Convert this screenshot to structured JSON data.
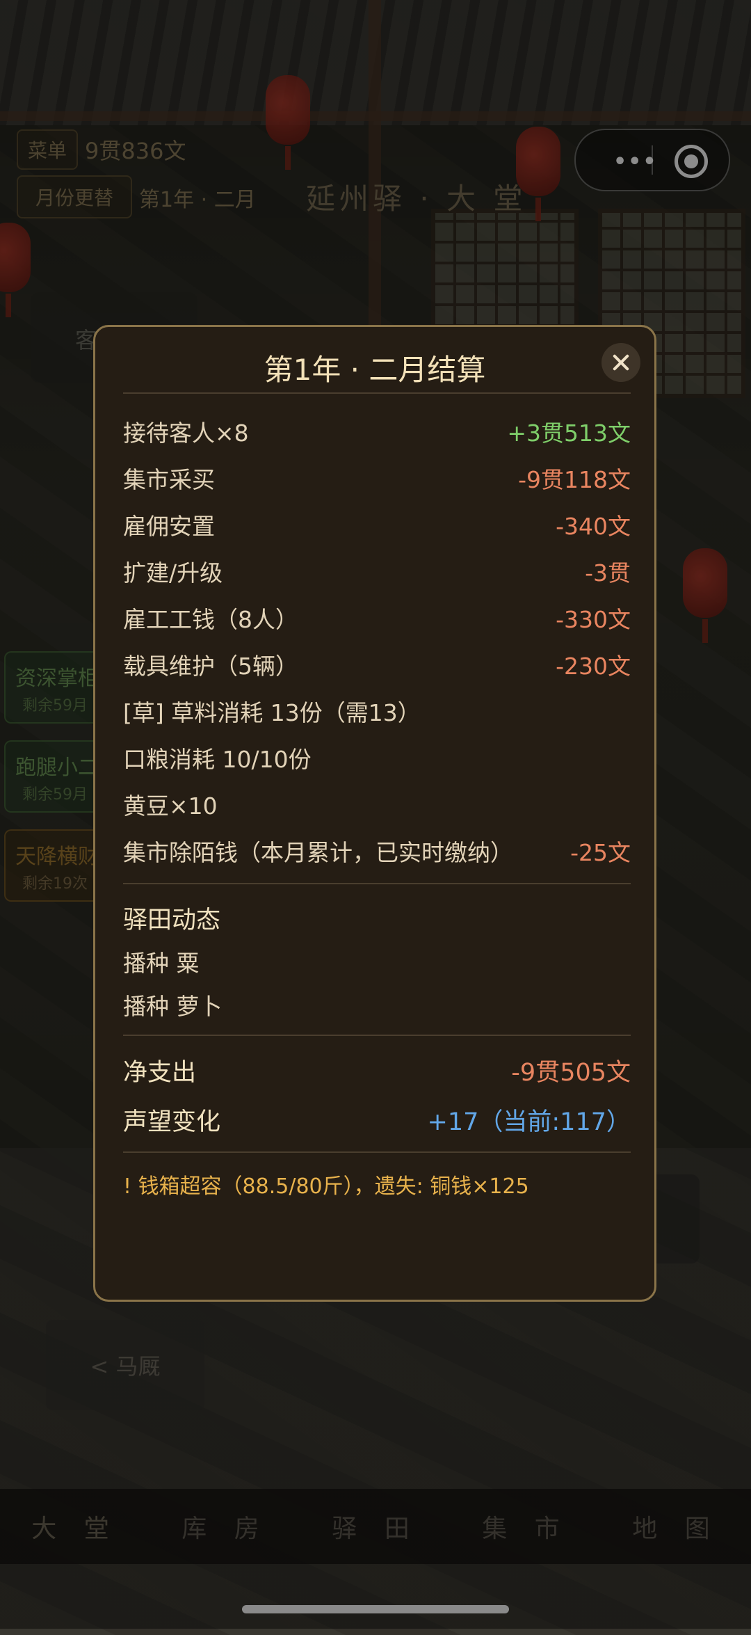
{
  "hud": {
    "menu_label": "菜单",
    "money": "9贯836文",
    "month_change_label": "月份更替",
    "date": "第1年 · 二月",
    "location_title": "延州驿 · 大 堂",
    "ghost_panel_text": "客"
  },
  "capsule": {
    "more_icon": "more-dots-icon",
    "close_icon": "target-icon"
  },
  "side_staff": [
    {
      "name": "资深掌柜",
      "remaining": "剩余59月"
    },
    {
      "name": "跑腿小二",
      "remaining": "剩余59月"
    },
    {
      "name": "天降横财",
      "remaining": "剩余19次"
    }
  ],
  "back_button_label": "< 马厩",
  "bottom_nav": [
    "大 堂",
    "库 房",
    "驿 田",
    "集 市",
    "地 图"
  ],
  "settlement": {
    "title": "第1年 · 二月结算",
    "lines": [
      {
        "label": "接待客人×8",
        "value": "+3贯513文",
        "tone": "pos"
      },
      {
        "label": "集市采买",
        "value": "-9贯118文",
        "tone": "neg"
      },
      {
        "label": "雇佣安置",
        "value": "-340文",
        "tone": "neg"
      },
      {
        "label": "扩建/升级",
        "value": "-3贯",
        "tone": "neg"
      },
      {
        "label": "雇工工钱（8人）",
        "value": "-330文",
        "tone": "neg"
      },
      {
        "label": "载具维护（5辆）",
        "value": "-230文",
        "tone": "neg"
      },
      {
        "label": "[草] 草料消耗 13份（需13）",
        "value": "",
        "tone": ""
      },
      {
        "label": "口粮消耗 10/10份",
        "value": "",
        "tone": ""
      },
      {
        "label": "黄豆×10",
        "value": "",
        "tone": ""
      },
      {
        "label": "集市除陌钱（本月累计，已实时缴纳）",
        "value": "-25文",
        "tone": "neg"
      }
    ],
    "farm_section_title": "驿田动态",
    "farm_lines": [
      "播种 粟",
      "播种 萝卜"
    ],
    "net_label": "净支出",
    "net_value": "-9贯505文",
    "reputation_label": "声望变化",
    "reputation_value": "+17（当前:117）",
    "warning": "! 钱箱超容（88.5/80斤），遗失: 铜钱×125"
  },
  "colors": {
    "positive": "#7fcf6a",
    "negative": "#e98560",
    "reputation": "#62a7e8",
    "warning": "#e8b24c",
    "modal_border": "#8a7449"
  }
}
